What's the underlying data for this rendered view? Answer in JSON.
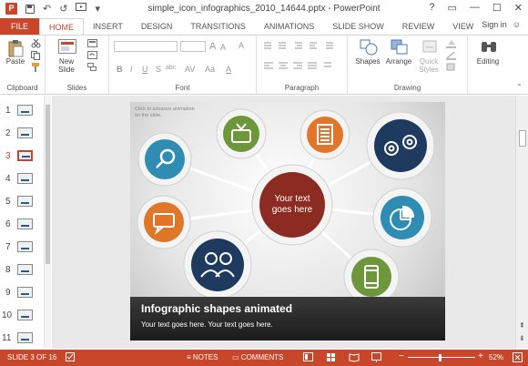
{
  "app": {
    "title": "simple_icon_infographics_2010_14644.pptx - PowerPoint",
    "logo_letter": "P",
    "help_glyph": "?",
    "window_controls": {
      "restore": "▭",
      "minimize": "—",
      "maximize": "☐",
      "close": "✕"
    }
  },
  "quick_access": {
    "undo": "↶",
    "redo": "↺",
    "customize": "▾"
  },
  "tabs": [
    {
      "label": "FILE"
    },
    {
      "label": "HOME"
    },
    {
      "label": "INSERT"
    },
    {
      "label": "DESIGN"
    },
    {
      "label": "TRANSITIONS"
    },
    {
      "label": "ANIMATIONS"
    },
    {
      "label": "SLIDE SHOW"
    },
    {
      "label": "REVIEW"
    },
    {
      "label": "VIEW"
    }
  ],
  "account": {
    "signin": "Sign in",
    "smiley": "☺"
  },
  "ribbon": {
    "clipboard": {
      "paste": "Paste",
      "label": "Clipboard"
    },
    "slides": {
      "new_slide": "New",
      "new_slide2": "Slide",
      "label": "Slides"
    },
    "font": {
      "bold": "B",
      "italic": "I",
      "underline": "U",
      "strike": "S",
      "shadow": "abc",
      "spacing": "AV",
      "case": "Aa",
      "color": "A",
      "grow": "A",
      "shrink": "A",
      "clear": "A",
      "label": "Font"
    },
    "paragraph": {
      "label": "Paragraph"
    },
    "drawing": {
      "shapes": "Shapes",
      "arrange": "Arrange",
      "quick_styles": "Quick",
      "quick_styles2": "Styles",
      "label": "Drawing"
    },
    "editing": {
      "label": "Editing"
    }
  },
  "thumbnails": {
    "selected": 3,
    "items": [
      {
        "num": "1"
      },
      {
        "num": "2"
      },
      {
        "num": "3"
      },
      {
        "num": "4"
      },
      {
        "num": "5"
      },
      {
        "num": "6"
      },
      {
        "num": "7"
      },
      {
        "num": "8"
      },
      {
        "num": "9"
      },
      {
        "num": "10"
      },
      {
        "num": "11"
      }
    ]
  },
  "slide": {
    "hint": "Click to advance animation on the slide.",
    "center_text": "Your text goes here",
    "heading": "Infographic shapes animated",
    "subtext": "Your text goes here. Your text goes here.",
    "colors": {
      "center": "#8c2b22",
      "green": "#6e963a",
      "orange": "#e0762a",
      "navy": "#1f3a5f",
      "teal": "#2f8db3"
    },
    "icons": [
      "search-icon",
      "tv-icon",
      "document-icon",
      "gears-icon",
      "chat-icon",
      "pie-chart-icon",
      "users-icon",
      "phone-icon"
    ]
  },
  "status": {
    "slide_of": "SLIDE 3 OF 16",
    "notes": "NOTES",
    "comments": "COMMENTS",
    "zoom": "52%",
    "minus": "−",
    "plus": "+"
  },
  "scroll": {
    "prev_slide": "⇞",
    "next_slide": "⇟"
  }
}
